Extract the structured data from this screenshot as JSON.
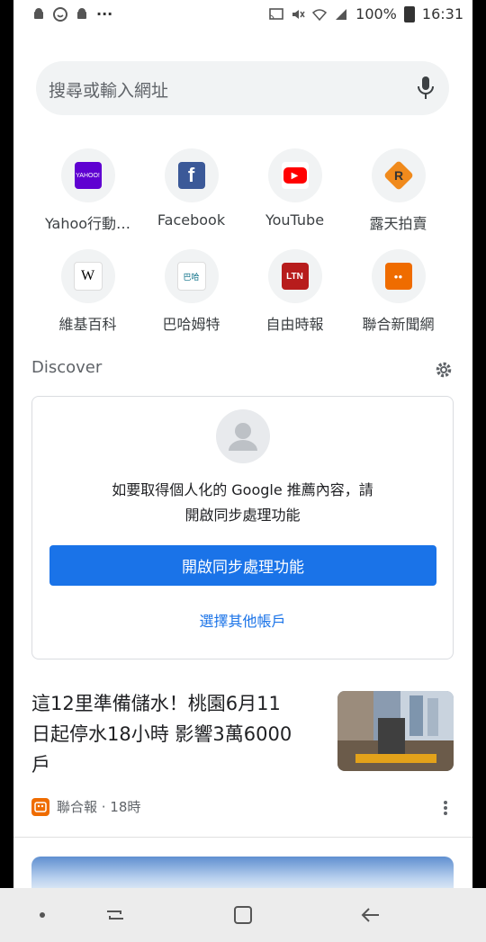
{
  "status_bar": {
    "battery": "100%",
    "time": "16:31",
    "more_indicator": "···",
    "left_icons": [
      "android-icon",
      "chat-icon",
      "android-icon"
    ],
    "right_icons": [
      "cast-icon",
      "mute-icon",
      "wifi-icon",
      "signal-icon",
      "battery-icon"
    ]
  },
  "search": {
    "placeholder": "搜尋或輸入網址",
    "icon": "mic-icon"
  },
  "shortcuts": [
    {
      "label": "Yahoo行動…",
      "icon": "yahoo-icon",
      "icon_text": "YAHOO!",
      "color": "#5f01d1"
    },
    {
      "label": "Facebook",
      "icon": "facebook-icon",
      "icon_text": "f",
      "color": "#1877f2"
    },
    {
      "label": "YouTube",
      "icon": "youtube-icon",
      "icon_text": "▶",
      "color": "#ff0000"
    },
    {
      "label": "露天拍賣",
      "icon": "ruten-icon",
      "icon_text": "R",
      "color": "#f08a1c"
    },
    {
      "label": "維基百科",
      "icon": "wikipedia-icon",
      "icon_text": "W",
      "color": "#ffffff"
    },
    {
      "label": "巴哈姆特",
      "icon": "bahamut-icon",
      "icon_text": "巴哈",
      "color": "#ffffff"
    },
    {
      "label": "自由時報",
      "icon": "ltn-icon",
      "icon_text": "LTN",
      "color": "#b71c1c"
    },
    {
      "label": "聯合新聞網",
      "icon": "udn-icon",
      "icon_text": "●●",
      "color": "#ef6c00"
    }
  ],
  "discover": {
    "title": "Discover",
    "settings_icon": "gear-icon"
  },
  "sync_card": {
    "message_line1": "如要取得個人化的 Google 推薦內容，請",
    "message_line2": "開啟同步處理功能",
    "primary_button": "開啟同步處理功能",
    "secondary_link": "選擇其他帳戶"
  },
  "article": {
    "headline": "這12里準備儲水！桃園6月11日起停水18小時 影響3萬6000戶",
    "source": "聯合報 · 18時",
    "thumbnail": "construction-site-image"
  },
  "colors": {
    "accent": "#1a73e8",
    "search_bg": "#f1f3f4",
    "source_badge": "#ef6c00"
  },
  "nav_bar": {
    "buttons": [
      "dot-icon",
      "recents-icon",
      "home-icon",
      "back-icon"
    ]
  }
}
